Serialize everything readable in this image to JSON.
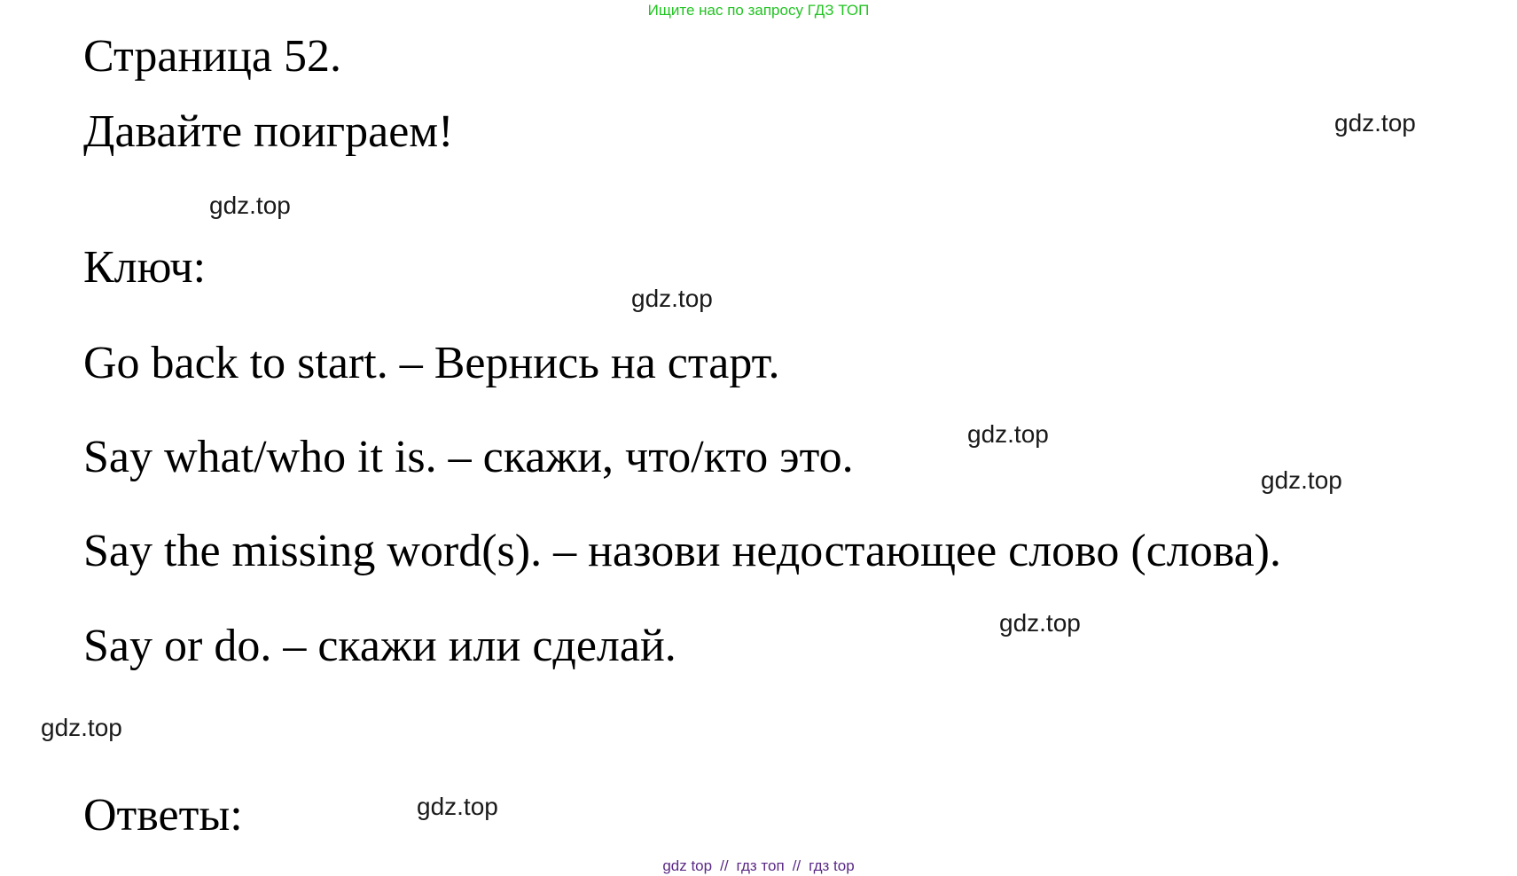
{
  "header": {
    "banner": "Ищите нас по запросу ГДЗ ТОП"
  },
  "document": {
    "page_title": "Страница 52.",
    "subtitle": "Давайте поиграем!",
    "key_label": "Ключ:",
    "lines": [
      "Go back to start. – Вернись на старт.",
      "Say what/who it is. – скажи, что/кто это.",
      "Say the missing word(s). – назови недостающее слово (слова).",
      "Say or do. – скажи или сделай."
    ],
    "answers_label": "Ответы:"
  },
  "watermark": "gdz.top",
  "footer": {
    "links": [
      "gdz top",
      "гдз топ",
      "гдз top"
    ],
    "separator": "//"
  }
}
